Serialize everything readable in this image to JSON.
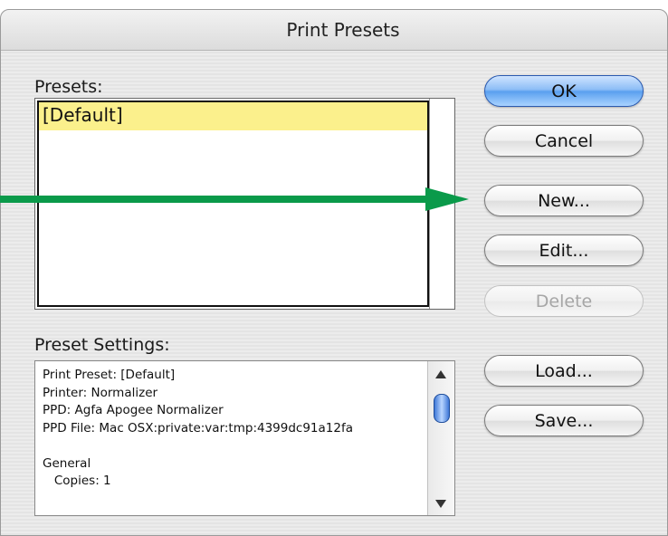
{
  "dialog": {
    "title": "Print Presets"
  },
  "presets": {
    "label": "Presets:",
    "items": [
      "[Default]"
    ]
  },
  "settings": {
    "label": "Preset Settings:",
    "lines": [
      "Print Preset: [Default]",
      "Printer: Normalizer",
      "PPD: Agfa Apogee Normalizer",
      "PPD File: Mac OSX:private:var:tmp:4399dc91a12fa",
      "",
      "General",
      "   Copies: 1"
    ]
  },
  "buttons": {
    "ok": "OK",
    "cancel": "Cancel",
    "new": "New...",
    "edit": "Edit...",
    "delete": "Delete",
    "load": "Load...",
    "save": "Save..."
  },
  "colors": {
    "annotation_arrow": "#0a9a4a",
    "selection": "#fbf08c",
    "default_button": "#5aa0ef"
  },
  "icons": {
    "annotation": "green-arrow-icon",
    "scroll_up": "scroll-up-icon",
    "scroll_down": "scroll-down-icon"
  }
}
